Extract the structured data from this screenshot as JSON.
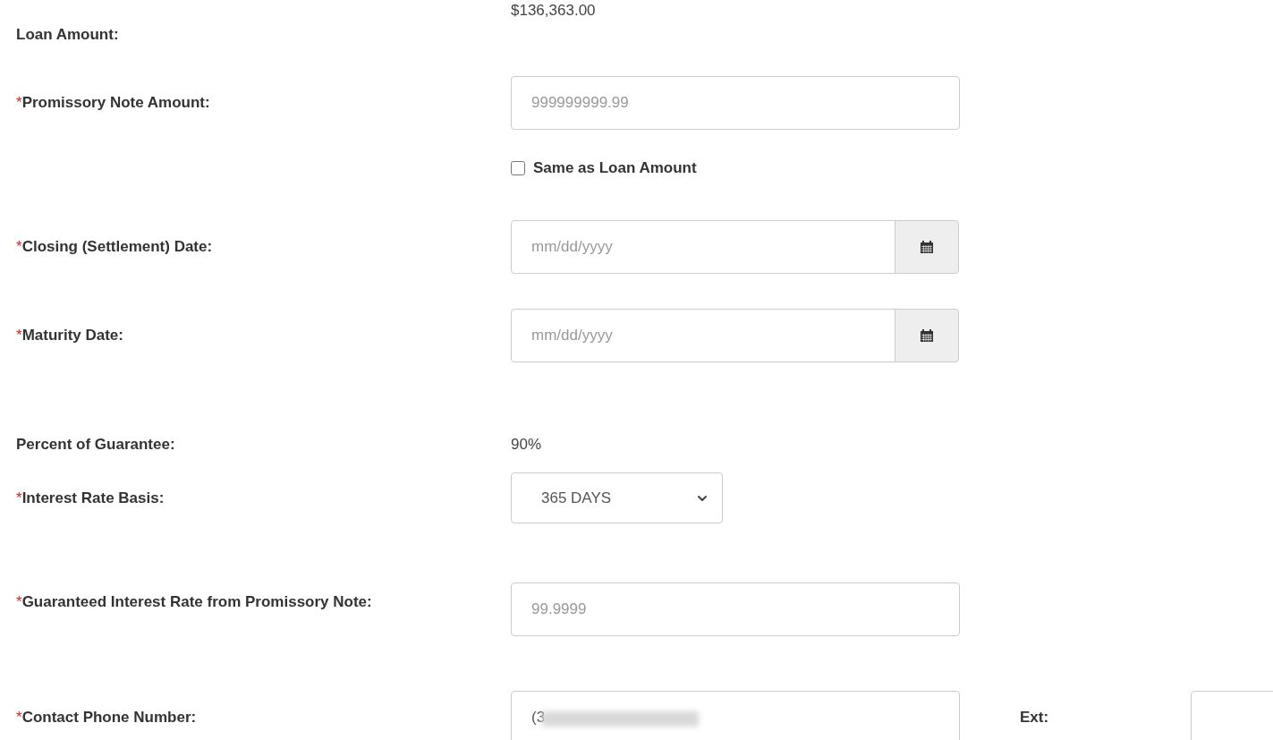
{
  "fields": [
    {
      "kind": "text",
      "label": "Loan Amount:",
      "value": "$136,363.00"
    },
    {
      "kind": "input",
      "required_mark": "*",
      "label": "Promissory Note Amount:",
      "placeholder": "999999999.99",
      "checkbox": {
        "label": "Same as Loan Amount",
        "checked": false
      }
    },
    {
      "kind": "date",
      "required_mark": "*",
      "label": "Closing (Settlement) Date:",
      "placeholder": "mm/dd/yyyy"
    },
    {
      "kind": "date",
      "required_mark": "*",
      "label": "Maturity Date:",
      "placeholder": "mm/dd/yyyy"
    },
    {
      "kind": "text",
      "label": "Percent of Guarantee:",
      "value": "90%"
    },
    {
      "kind": "select",
      "required_mark": "*",
      "label": "Interest Rate Basis:",
      "value": "365 DAYS"
    },
    {
      "kind": "input",
      "required_mark": "*",
      "label": "Guaranteed Interest Rate from Promissory Note:",
      "placeholder": "99.9999"
    },
    {
      "kind": "phone",
      "required_mark": "*",
      "label": "Contact Phone Number:",
      "value": "(3",
      "ext": {
        "label": "Ext:"
      }
    }
  ]
}
